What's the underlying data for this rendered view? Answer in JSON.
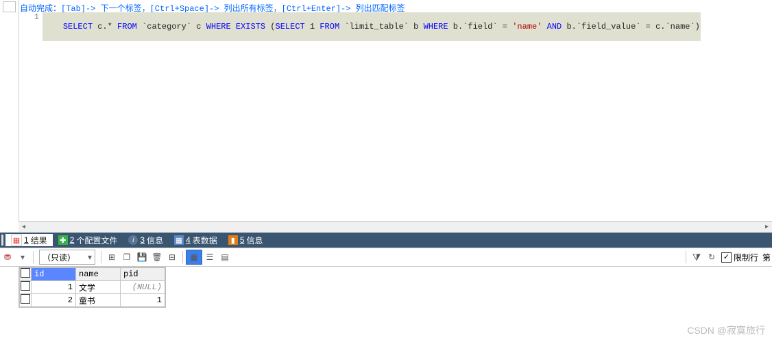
{
  "hint": "自动完成：[Tab]-> 下一个标签，[Ctrl+Space]-> 列出所有标签，[Ctrl+Enter]-> 列出匹配标签",
  "line_number": "1",
  "sql": {
    "t1": "SELECT",
    "t2": " c.* ",
    "t3": "FROM",
    "t4": " `category` c ",
    "t5": "WHERE EXISTS",
    "t6": " (",
    "t7": "SELECT",
    "t8": " 1 ",
    "t9": "FROM",
    "t10": " `limit_table` b ",
    "t11": "WHERE",
    "t12": " b.`field` = ",
    "t13": "'name'",
    "t14": " ",
    "t15": "AND",
    "t16": " b.`field_value` = c.`name`)"
  },
  "tabs": {
    "result_num": "1",
    "result_label": "结果",
    "profile_num": "2",
    "profile_label": "个配置文件",
    "info_num": "3",
    "info_label": "信息",
    "tabledata_num": "4",
    "tabledata_label": "表数据",
    "msg_num": "5",
    "msg_label": "信息"
  },
  "toolbar": {
    "mode": "（只读）",
    "limit_label": "限制行",
    "first_label": "第"
  },
  "grid": {
    "headers": {
      "c0": "id",
      "c1": "name",
      "c2": "pid"
    },
    "rows": [
      {
        "id": "1",
        "name": "文学",
        "pid": "(NULL)",
        "pid_null": true
      },
      {
        "id": "2",
        "name": "童书",
        "pid": "1",
        "pid_null": false
      }
    ]
  },
  "chart_data": {
    "type": "table",
    "headers": [
      "id",
      "name",
      "pid"
    ],
    "rows": [
      [
        1,
        "文学",
        null
      ],
      [
        2,
        "童书",
        1
      ]
    ]
  },
  "watermark": "CSDN @寂寞旅行"
}
